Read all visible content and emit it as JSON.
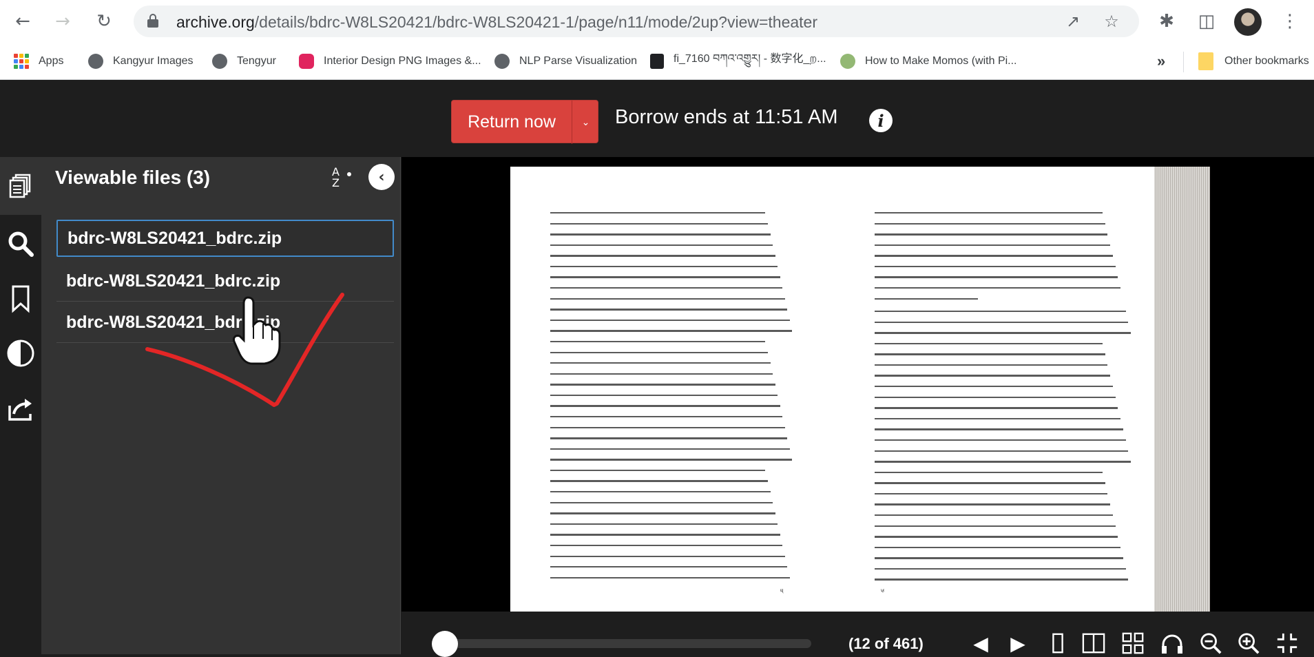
{
  "browser": {
    "url_host": "archive.org",
    "url_path": "/details/bdrc-W8LS20421/bdrc-W8LS20421-1/page/n11/mode/2up?view=theater",
    "bookmarks": [
      {
        "label": "Apps",
        "icon": "apps-grid-icon"
      },
      {
        "label": "Kangyur Images",
        "icon": "globe-icon"
      },
      {
        "label": "Tengyur",
        "icon": "globe-icon"
      },
      {
        "label": "Interior Design PNG Images &...",
        "icon": "pngtree-icon"
      },
      {
        "label": "NLP Parse Visualization",
        "icon": "globe-icon"
      },
      {
        "label": "fi_7160 བཀའ་འགྱུར། - 数字化_ற...",
        "icon": "book-icon"
      },
      {
        "label": "How to Make Momos (with Pi...",
        "icon": "wikihow-icon"
      },
      {
        "label": "Other bookmarks",
        "icon": "folder-icon"
      }
    ],
    "overflow": "»"
  },
  "topbar": {
    "return_label": "Return now",
    "borrow_text": "Borrow ends at 11:51 AM",
    "info_glyph": "i"
  },
  "panel": {
    "title": "Viewable files (3)",
    "sort_label": "A Z",
    "files": [
      {
        "name": "bdrc-W8LS20421_bdrc.zip",
        "selected": true
      },
      {
        "name": "bdrc-W8LS20421_bdrc.zip",
        "selected": false
      },
      {
        "name": "bdrc-W8LS20421_bdrc.zip",
        "selected": false
      }
    ]
  },
  "book": {
    "left_page_num": "༥",
    "right_page_num": "༦"
  },
  "nav": {
    "page_counter": "(12 of 461)",
    "progress_fraction": 0.024
  },
  "colors": {
    "return_button": "#d9423d",
    "selected_border": "#428bca",
    "annotation_check": "#e32626"
  }
}
